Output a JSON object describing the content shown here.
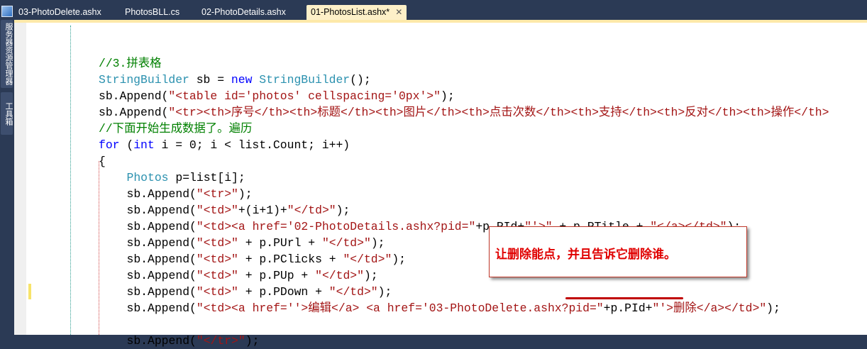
{
  "sidebar": {
    "server_explorer": "服务器资源管理器",
    "toolbox": "工具箱"
  },
  "tabs": [
    {
      "label": "03-PhotoDelete.ashx",
      "active": false
    },
    {
      "label": "PhotosBLL.cs",
      "active": false
    },
    {
      "label": "02-PhotoDetails.ashx",
      "active": false
    },
    {
      "label": "01-PhotosList.ashx*",
      "active": true
    }
  ],
  "close_glyph": "✕",
  "code_lines": [
    {
      "indent": 0,
      "tokens": []
    },
    {
      "indent": 1,
      "tokens": [
        [
          "//3.拼表格",
          "comment"
        ]
      ]
    },
    {
      "indent": 1,
      "tokens": [
        [
          "StringBuilder",
          "type"
        ],
        [
          " sb = ",
          "plain"
        ],
        [
          "new",
          "keyword"
        ],
        [
          " ",
          "plain"
        ],
        [
          "StringBuilder",
          "type"
        ],
        [
          "();",
          "plain"
        ]
      ]
    },
    {
      "indent": 1,
      "tokens": [
        [
          "sb.Append(",
          "plain"
        ],
        [
          "\"<table id='photos' cellspacing='0px'>\"",
          "string"
        ],
        [
          ");",
          "plain"
        ]
      ]
    },
    {
      "indent": 1,
      "tokens": [
        [
          "sb.Append(",
          "plain"
        ],
        [
          "\"<tr><th>序号</th><th>标题</th><th>图片</th><th>点击次数</th><th>支持</th><th>反对</th><th>操作</th>",
          "string"
        ]
      ]
    },
    {
      "indent": 1,
      "tokens": [
        [
          "//下面开始生成数据了。遍历",
          "comment"
        ]
      ]
    },
    {
      "indent": 1,
      "tokens": [
        [
          "for",
          "keyword"
        ],
        [
          " (",
          "plain"
        ],
        [
          "int",
          "keyword"
        ],
        [
          " i = 0; i < list.Count; i++)",
          "plain"
        ]
      ]
    },
    {
      "indent": 1,
      "tokens": [
        [
          "{",
          "plain"
        ]
      ]
    },
    {
      "indent": 2,
      "tokens": [
        [
          "Photos",
          "type"
        ],
        [
          " p=list[i];",
          "plain"
        ]
      ]
    },
    {
      "indent": 2,
      "tokens": [
        [
          "sb.Append(",
          "plain"
        ],
        [
          "\"<tr>\"",
          "string"
        ],
        [
          ");",
          "plain"
        ]
      ]
    },
    {
      "indent": 2,
      "tokens": [
        [
          "sb.Append(",
          "plain"
        ],
        [
          "\"<td>\"",
          "string"
        ],
        [
          "+(i+1)+",
          "plain"
        ],
        [
          "\"</td>\"",
          "string"
        ],
        [
          ");",
          "plain"
        ]
      ]
    },
    {
      "indent": 2,
      "tokens": [
        [
          "sb.Append(",
          "plain"
        ],
        [
          "\"<td><a href='02-PhotoDetails.ashx?pid=\"",
          "string"
        ],
        [
          "+p.PId+",
          "plain"
        ],
        [
          "\"'>\"",
          "string"
        ],
        [
          " + p.PTitle + ",
          "plain"
        ],
        [
          "\"</a></td>\"",
          "string"
        ],
        [
          ");",
          "plain"
        ]
      ]
    },
    {
      "indent": 2,
      "tokens": [
        [
          "sb.Append(",
          "plain"
        ],
        [
          "\"<td>\"",
          "string"
        ],
        [
          " + p.PUrl + ",
          "plain"
        ],
        [
          "\"</td>\"",
          "string"
        ],
        [
          ");",
          "plain"
        ]
      ]
    },
    {
      "indent": 2,
      "tokens": [
        [
          "sb.Append(",
          "plain"
        ],
        [
          "\"<td>\"",
          "string"
        ],
        [
          " + p.PClicks + ",
          "plain"
        ],
        [
          "\"</td>\"",
          "string"
        ],
        [
          ");",
          "plain"
        ]
      ]
    },
    {
      "indent": 2,
      "tokens": [
        [
          "sb.Append(",
          "plain"
        ],
        [
          "\"<td>\"",
          "string"
        ],
        [
          " + p.PUp + ",
          "plain"
        ],
        [
          "\"</td>\"",
          "string"
        ],
        [
          ");",
          "plain"
        ]
      ]
    },
    {
      "indent": 2,
      "tokens": [
        [
          "sb.Append(",
          "plain"
        ],
        [
          "\"<td>\"",
          "string"
        ],
        [
          " + p.PDown + ",
          "plain"
        ],
        [
          "\"</td>\"",
          "string"
        ],
        [
          ");",
          "plain"
        ]
      ]
    },
    {
      "indent": 2,
      "tokens": [
        [
          "sb.Append(",
          "plain"
        ],
        [
          "\"<td><a href=''>编辑</a> <a href='03-PhotoDelete.ashx?pid=\"",
          "string"
        ],
        [
          "+p.PId+",
          "plain"
        ],
        [
          "\"'>删除</a></td>\"",
          "string"
        ],
        [
          ");",
          "plain"
        ]
      ]
    },
    {
      "indent": 0,
      "tokens": []
    },
    {
      "indent": 2,
      "tokens": [
        [
          "sb.Append(",
          "plain"
        ],
        [
          "\"</tr>\"",
          "string"
        ],
        [
          ");",
          "plain"
        ]
      ]
    }
  ],
  "annotation": {
    "text": "让删除能点，并且告诉它删除谁。",
    "color": "#e00000"
  }
}
